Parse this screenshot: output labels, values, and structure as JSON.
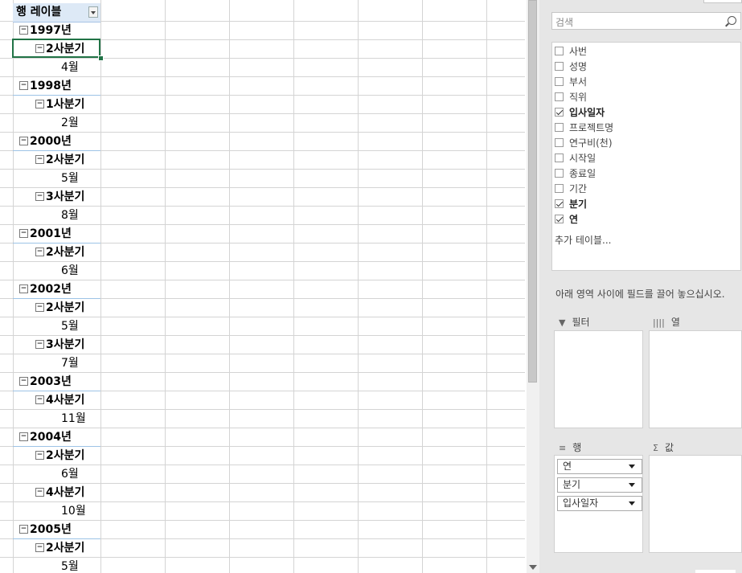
{
  "pivot": {
    "header_label": "행 레이블",
    "rows": [
      {
        "level": "year",
        "label": "1997년",
        "toggle": "⊟"
      },
      {
        "level": "qtr",
        "label": "2사분기",
        "toggle": "⊟"
      },
      {
        "level": "month",
        "label": "4월"
      },
      {
        "level": "year",
        "label": "1998년",
        "toggle": "⊟"
      },
      {
        "level": "qtr",
        "label": "1사분기",
        "toggle": "⊟"
      },
      {
        "level": "month",
        "label": "2월"
      },
      {
        "level": "year",
        "label": "2000년",
        "toggle": "⊟"
      },
      {
        "level": "qtr",
        "label": "2사분기",
        "toggle": "⊟"
      },
      {
        "level": "month",
        "label": "5월"
      },
      {
        "level": "qtr",
        "label": "3사분기",
        "toggle": "⊟"
      },
      {
        "level": "month",
        "label": "8월"
      },
      {
        "level": "year",
        "label": "2001년",
        "toggle": "⊟"
      },
      {
        "level": "qtr",
        "label": "2사분기",
        "toggle": "⊟"
      },
      {
        "level": "month",
        "label": "6월"
      },
      {
        "level": "year",
        "label": "2002년",
        "toggle": "⊟"
      },
      {
        "level": "qtr",
        "label": "2사분기",
        "toggle": "⊟"
      },
      {
        "level": "month",
        "label": "5월"
      },
      {
        "level": "qtr",
        "label": "3사분기",
        "toggle": "⊟"
      },
      {
        "level": "month",
        "label": "7월"
      },
      {
        "level": "year",
        "label": "2003년",
        "toggle": "⊟"
      },
      {
        "level": "qtr",
        "label": "4사분기",
        "toggle": "⊟"
      },
      {
        "level": "month",
        "label": "11월"
      },
      {
        "level": "year",
        "label": "2004년",
        "toggle": "⊟"
      },
      {
        "level": "qtr",
        "label": "2사분기",
        "toggle": "⊟"
      },
      {
        "level": "month",
        "label": "6월"
      },
      {
        "level": "qtr",
        "label": "4사분기",
        "toggle": "⊟"
      },
      {
        "level": "month",
        "label": "10월"
      },
      {
        "level": "year",
        "label": "2005년",
        "toggle": "⊟"
      },
      {
        "level": "qtr",
        "label": "2사분기",
        "toggle": "⊟"
      },
      {
        "level": "month",
        "label": "5월"
      }
    ]
  },
  "field_pane": {
    "search_placeholder": "검색",
    "fields": [
      {
        "label": "사번",
        "checked": false
      },
      {
        "label": "성명",
        "checked": false
      },
      {
        "label": "부서",
        "checked": false
      },
      {
        "label": "직위",
        "checked": false
      },
      {
        "label": "입사일자",
        "checked": true
      },
      {
        "label": "프로젝트명",
        "checked": false
      },
      {
        "label": "연구비(천)",
        "checked": false
      },
      {
        "label": "시작일",
        "checked": false
      },
      {
        "label": "종료일",
        "checked": false
      },
      {
        "label": "기간",
        "checked": false
      },
      {
        "label": "분기",
        "checked": true
      },
      {
        "label": "연",
        "checked": true
      }
    ],
    "add_table": "추가 테이블...",
    "hint": "아래 영역 사이에 필드를 끌어 놓으십시오.",
    "areas": {
      "filter": {
        "title": "필터",
        "icon": "▼"
      },
      "columns": {
        "title": "열",
        "icon": "||||"
      },
      "rows": {
        "title": "행",
        "icon": "≡",
        "items": [
          "연",
          "분기",
          "입사일자"
        ]
      },
      "values": {
        "title": "값",
        "icon": "Σ"
      }
    }
  }
}
